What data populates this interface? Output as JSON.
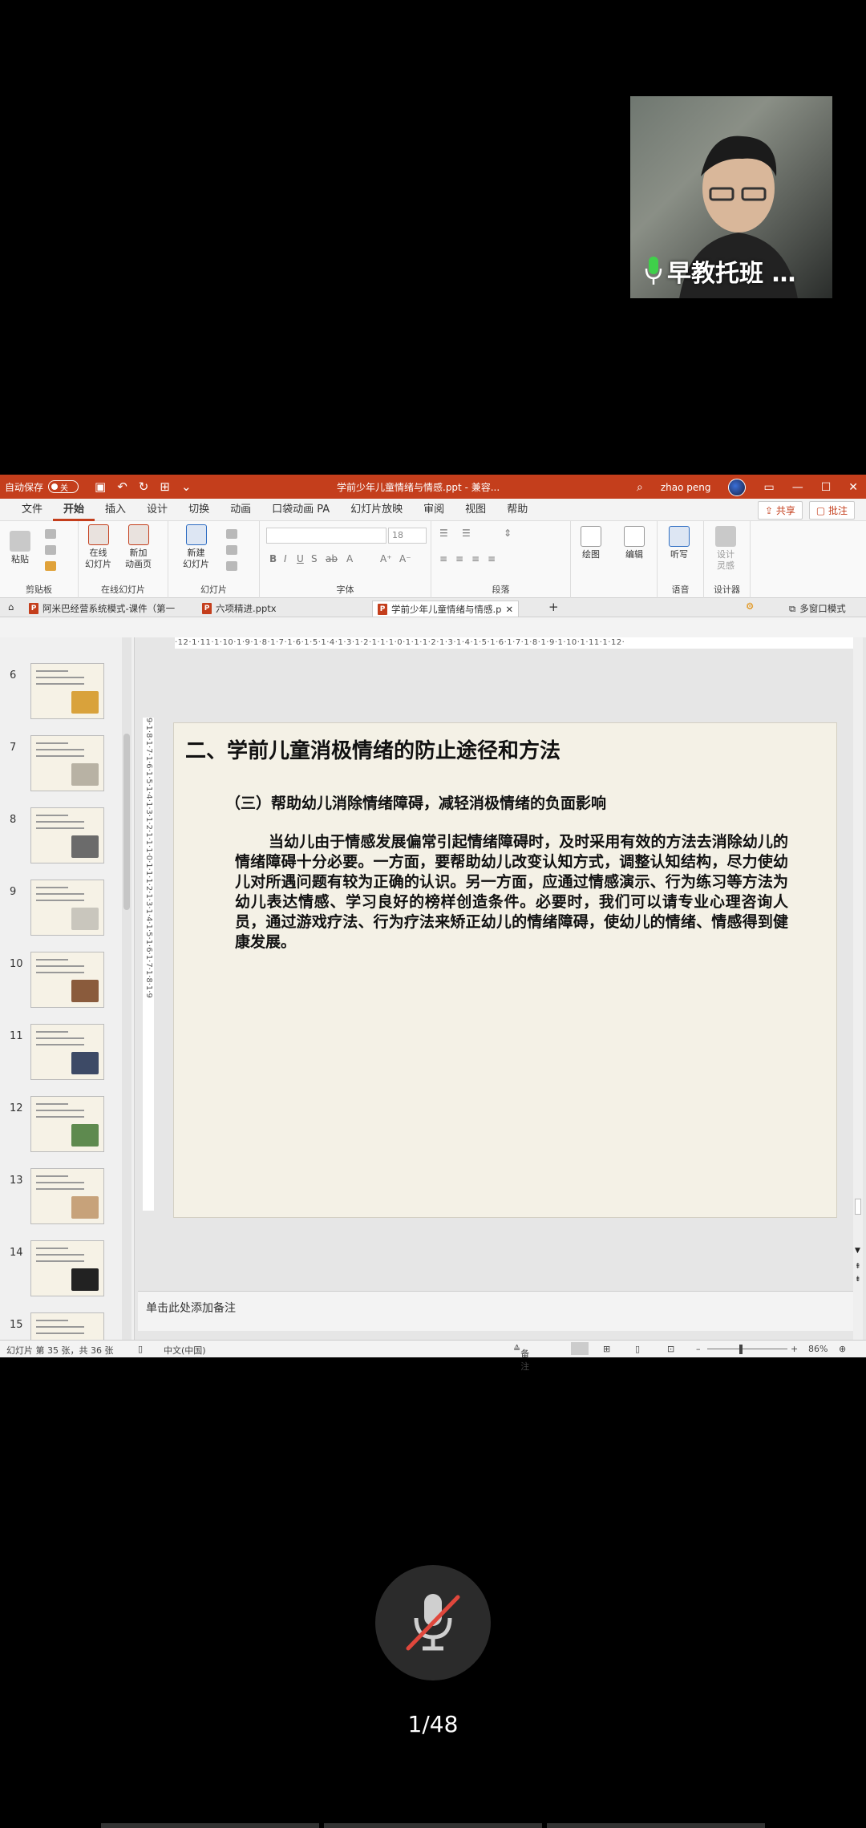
{
  "video": {
    "name": "早教托班 …"
  },
  "titlebar": {
    "autosave_label": "自动保存",
    "toggle_label": "关",
    "doc_title": "学前少年儿童情绪与情感.ppt  -  兼容...",
    "user_name": "zhao peng"
  },
  "menu": {
    "tabs": [
      "文件",
      "开始",
      "插入",
      "设计",
      "切换",
      "动画",
      "口袋动画 PA",
      "幻灯片放映",
      "审阅",
      "视图",
      "帮助"
    ],
    "share": "共享",
    "comment": "批注"
  },
  "ribbon": {
    "paste": "粘贴",
    "clipboard": "剪贴板",
    "online_slides": "在线\n幻灯片",
    "new_animation_page": "新加\n动画页",
    "online_slides_group": "在线幻灯片",
    "new_slide": "新建\n幻灯片",
    "slides_group": "幻灯片",
    "font_size": "18",
    "font_group": "字体",
    "paragraph_group": "段落",
    "draw": "绘图",
    "edit": "编辑",
    "dictate": "听写",
    "voice_group": "语音",
    "designer": "设计\n灵感",
    "designer_group": "设计器"
  },
  "doctabs": {
    "tab1": "阿米巴经营系统模式-课件（第一",
    "tab2": "六项精进.pptx",
    "tab3": "学前少年儿童情绪与情感.p",
    "multi_window": "多窗口模式"
  },
  "thumbnails": [
    "6",
    "7",
    "8",
    "9",
    "10",
    "11",
    "12",
    "13",
    "14",
    "15"
  ],
  "ruler": {
    "horizontal": "·12·1·11·1·10·1·9·1·8·1·7·1·6·1·5·1·4·1·3·1·2·1·1·1·0·1·1·1·2·1·3·1·4·1·5·1·6·1·7·1·8·1·9·1·10·1·11·1·12·",
    "vertical": "9·1·8·1·7·1·6·1·5·1·4·1·3·1·2·1·1·1·0·1·1·1·2·1·3·1·4·1·5·1·6·1·7·1·8·1·9"
  },
  "slide": {
    "title": "二、学前儿童消极情绪的防止途径和方法",
    "subtitle": "（三）帮助幼儿消除情绪障碍，减轻消极情绪的负面影响",
    "body": "当幼儿由于情感发展偏常引起情绪障碍时，及时采用有效的方法去消除幼儿的情绪障碍十分必要。一方面，要帮助幼儿改变认知方式，调整认知结构，尽力使幼儿对所遇问题有较为正确的认识。另一方面，应通过情感演示、行为练习等方法为幼儿表达情感、学习良好的榜样创造条件。必要时，我们可以请专业心理咨询人员，通过游戏疗法、行为疗法来矫正幼儿的情绪障碍，使幼儿的情绪、情感得到健康发展。"
  },
  "notes": {
    "placeholder": "单击此处添加备注"
  },
  "status": {
    "slide_info": "幻灯片 第 35 张，共 36 张",
    "language": "中文(中国)",
    "notes_btn": "备注",
    "zoom": "86%"
  },
  "bottom": {
    "page_count": "1/48"
  }
}
